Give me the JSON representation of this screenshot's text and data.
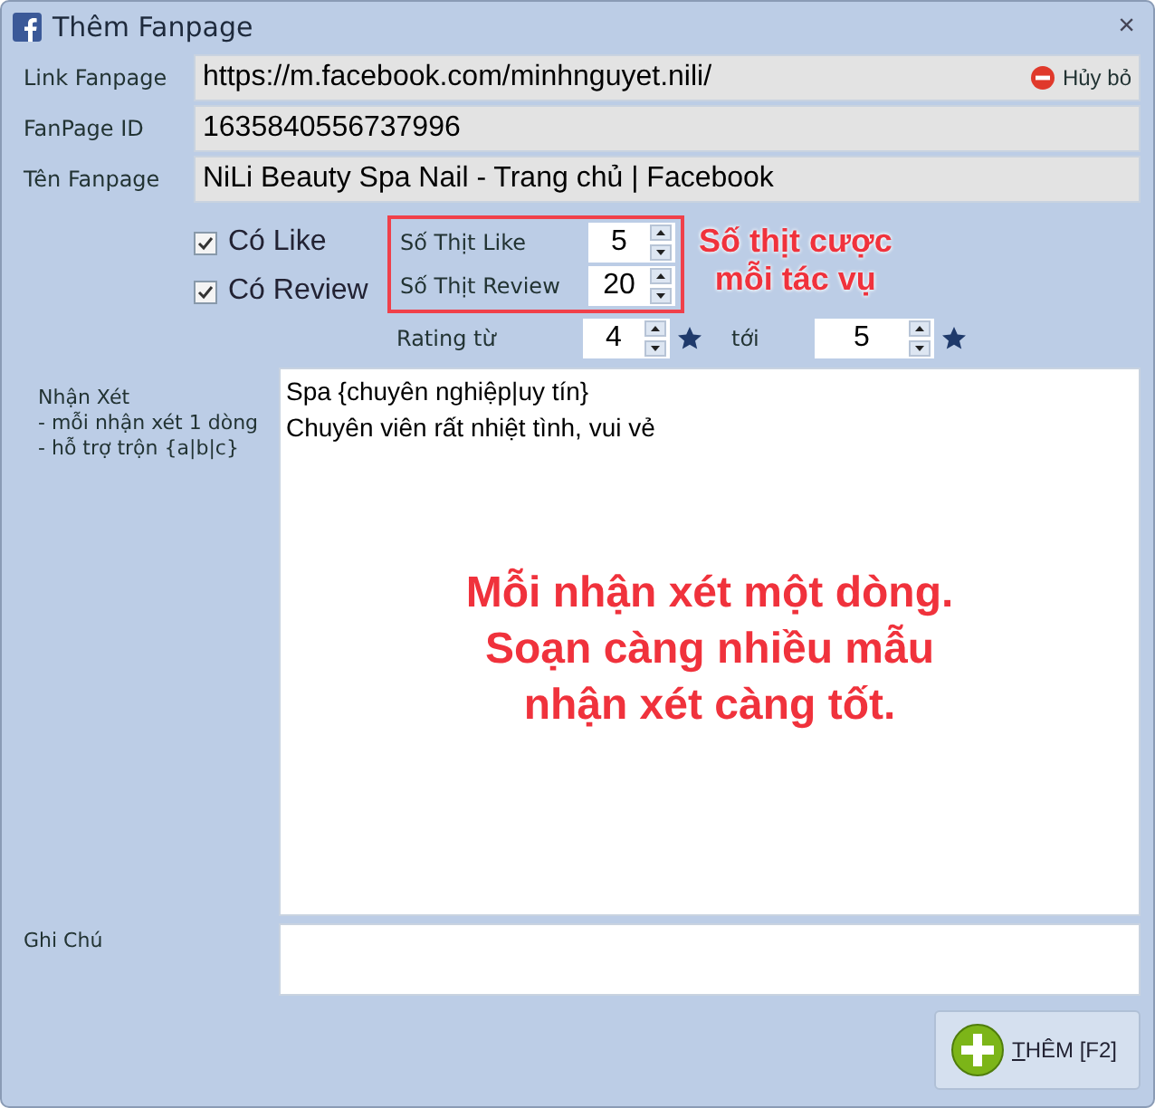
{
  "window": {
    "title": "Thêm Fanpage",
    "close": "×"
  },
  "fields": [
    {
      "label": "Link Fanpage",
      "value": "https://m.facebook.com/minhnguyet.nili/",
      "action": "Hủy bỏ"
    },
    {
      "label": "FanPage ID",
      "value": "1635840556737996"
    },
    {
      "label": "Tên Fanpage",
      "value": "NiLi Beauty Spa Nail - Trang chủ | Facebook"
    }
  ],
  "options": [
    {
      "label": "Có Like",
      "checked": true,
      "count_label": "Số Thịt Like",
      "count": "5"
    },
    {
      "label": "Có Review",
      "checked": true,
      "count_label": "Số Thịt Review",
      "count": "20"
    }
  ],
  "rating": {
    "label": "Rating từ",
    "from": "4",
    "to_label": "tới",
    "to": "5"
  },
  "comments": {
    "label": "Nhận Xét",
    "hints": [
      "- mỗi nhận xét 1 dòng",
      "- hỗ trợ trộn {a|b|c}"
    ],
    "lines": [
      "Spa {chuyên nghiệp|uy tín}",
      "Chuyên viên rất nhiệt tình, vui vẻ"
    ]
  },
  "note": {
    "label": "Ghi Chú"
  },
  "annotations": [
    {
      "kind": "side",
      "text": "Số thịt cược\nmỗi tác vụ"
    },
    {
      "kind": "center",
      "text": "Mỗi nhận xét một dòng.\nSoạn càng nhiều mẫu\nnhận xét càng tốt."
    }
  ],
  "button": {
    "label": "THÊM [F2]"
  }
}
